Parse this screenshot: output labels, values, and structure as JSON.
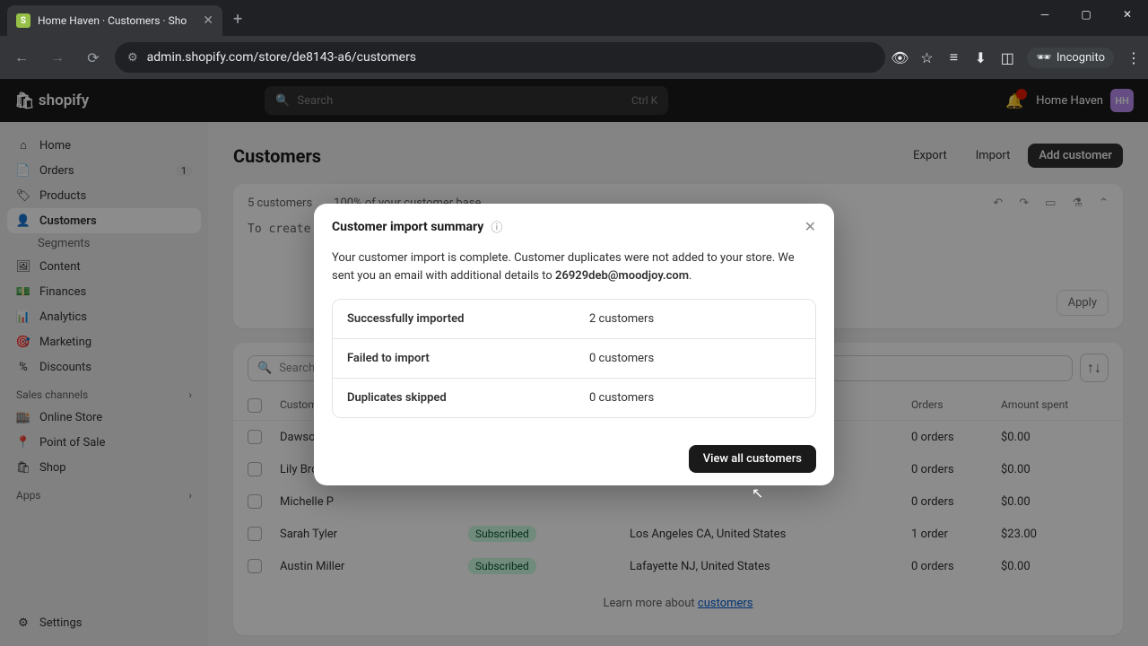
{
  "browser": {
    "tab_title": "Home Haven · Customers · Sho",
    "url": "admin.shopify.com/store/de8143-a6/customers",
    "incognito": "Incognito"
  },
  "topbar": {
    "logo": "shopify",
    "search_placeholder": "Search",
    "search_kbd": "Ctrl K",
    "store_name": "Home Haven",
    "store_initials": "HH"
  },
  "sidebar": {
    "items": [
      {
        "icon": "⌂",
        "label": "Home"
      },
      {
        "icon": "📄",
        "label": "Orders",
        "badge": "1"
      },
      {
        "icon": "🏷",
        "label": "Products"
      },
      {
        "icon": "👤",
        "label": "Customers",
        "active": true
      },
      {
        "sub": "Segments"
      },
      {
        "icon": "🖼",
        "label": "Content"
      },
      {
        "icon": "💵",
        "label": "Finances"
      },
      {
        "icon": "📊",
        "label": "Analytics"
      },
      {
        "icon": "🎯",
        "label": "Marketing"
      },
      {
        "icon": "%",
        "label": "Discounts"
      }
    ],
    "sales_channels": "Sales channels",
    "channels": [
      {
        "icon": "🏬",
        "label": "Online Store"
      },
      {
        "icon": "📍",
        "label": "Point of Sale"
      },
      {
        "icon": "🛍",
        "label": "Shop"
      }
    ],
    "apps": "Apps",
    "settings": "Settings"
  },
  "page": {
    "title": "Customers",
    "export": "Export",
    "import": "Import",
    "add_customer": "Add customer",
    "count": "5 customers",
    "base_pct": "100% of your customer base",
    "query": "To create a s",
    "apply": "Apply",
    "search_placeholder": "Search customers",
    "columns": {
      "name": "Customer name",
      "orders": "Orders",
      "amount": "Amount spent"
    },
    "rows": [
      {
        "name": "Dawson",
        "sub": "",
        "loc": "",
        "orders": "0 orders",
        "amount": "$0.00"
      },
      {
        "name": "Lily Brown",
        "sub": "",
        "loc": "",
        "orders": "0 orders",
        "amount": "$0.00"
      },
      {
        "name": "Michelle P",
        "sub": "",
        "loc": "",
        "orders": "0 orders",
        "amount": "$0.00"
      },
      {
        "name": "Sarah Tyler",
        "sub": "Subscribed",
        "loc": "Los Angeles CA, United States",
        "orders": "1 order",
        "amount": "$23.00"
      },
      {
        "name": "Austin Miller",
        "sub": "Subscribed",
        "loc": "Lafayette NJ, United States",
        "orders": "0 orders",
        "amount": "$0.00"
      }
    ],
    "learn_prefix": "Learn more about ",
    "learn_link": "customers"
  },
  "modal": {
    "title": "Customer import summary",
    "desc_prefix": "Your customer import is complete. Customer duplicates were not added to your store. We sent you an email with additional details to ",
    "desc_email": "26929deb@moodjoy.com",
    "rows": [
      {
        "label": "Successfully imported",
        "value": "2 customers"
      },
      {
        "label": "Failed to import",
        "value": "0 customers"
      },
      {
        "label": "Duplicates skipped",
        "value": "0 customers"
      }
    ],
    "cta": "View all customers"
  }
}
